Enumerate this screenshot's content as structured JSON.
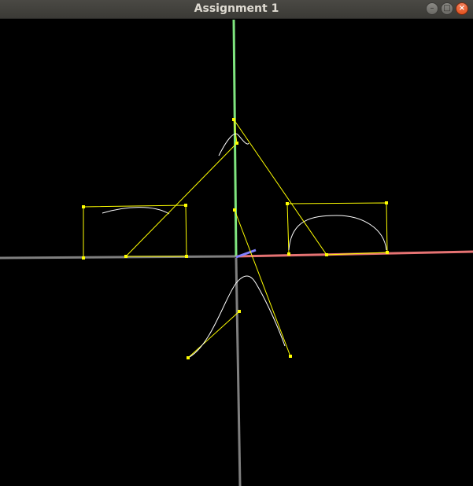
{
  "window": {
    "title": "Assignment 1",
    "controls": {
      "minimize_glyph": "–",
      "maximize_glyph": "□",
      "close_glyph": "×"
    }
  },
  "scene": {
    "colors": {
      "background": "#000000",
      "y_axis": "#7fe57f",
      "x_axis": "#e67373",
      "z_axis": "#8080ff",
      "negative_axis": "#7f7f7f",
      "control_polygon": "#ffff00",
      "curve": "#ffffff"
    }
  }
}
